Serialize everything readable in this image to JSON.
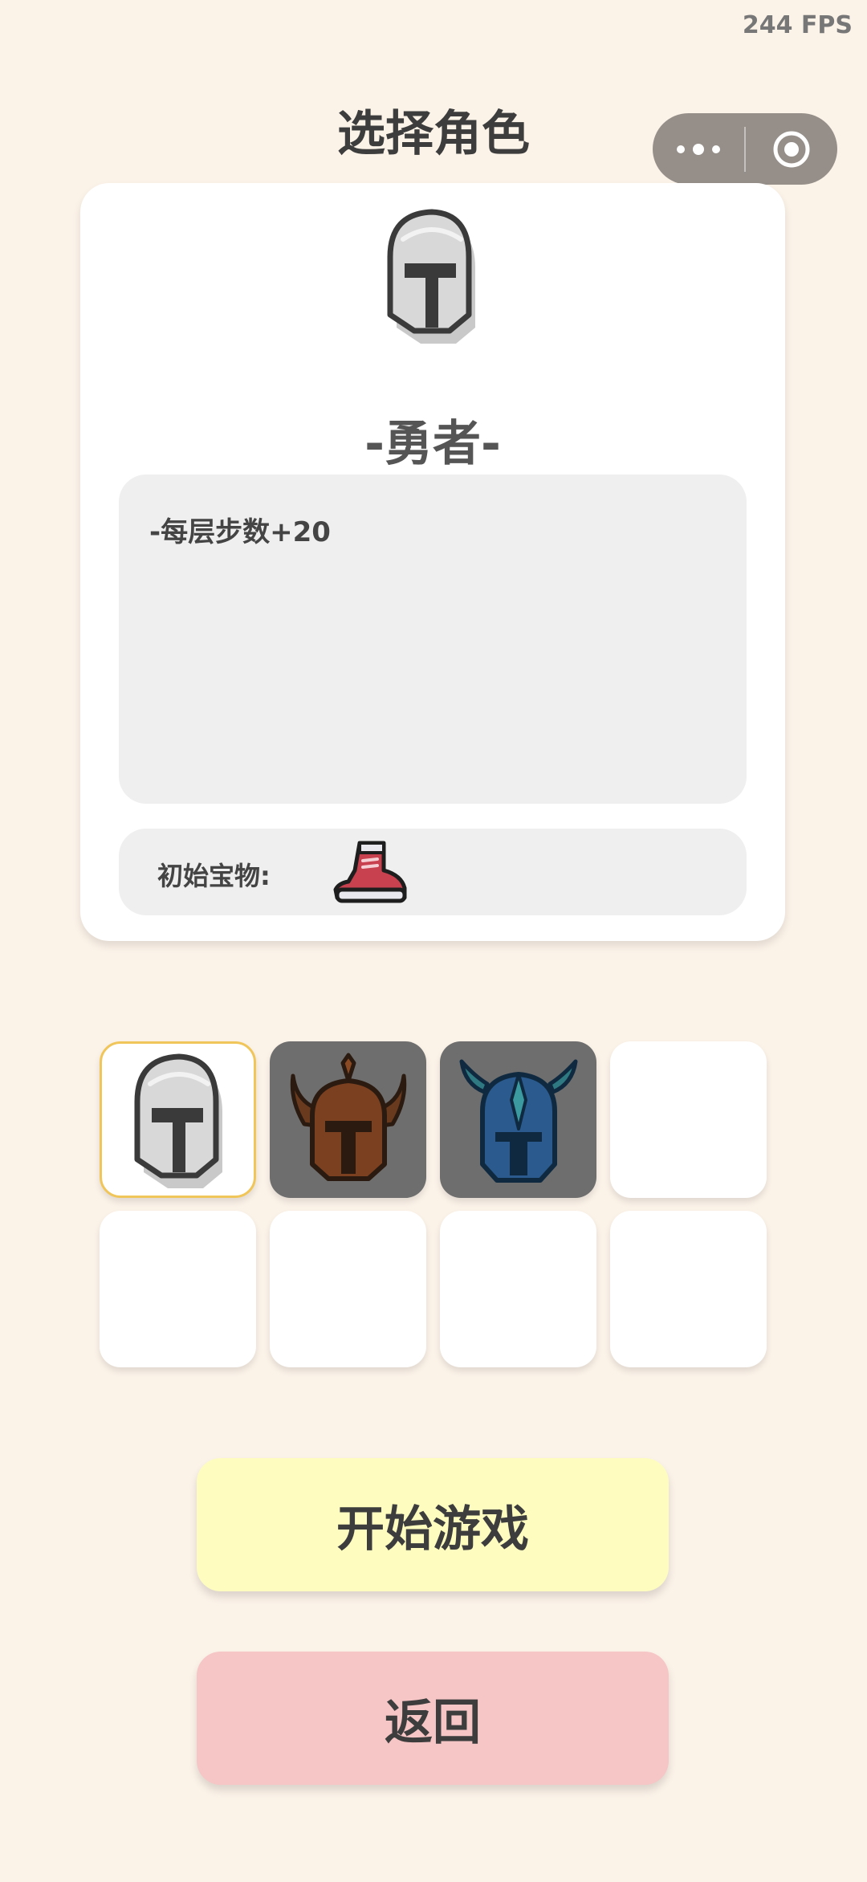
{
  "status": {
    "fps": "244 FPS"
  },
  "header": {
    "title": "选择角色"
  },
  "miniprogram_capsule": {
    "more_icon": "more-dots-icon",
    "close_icon": "target-circle-icon"
  },
  "character": {
    "name": "-勇者-",
    "description": "-每层步数+20",
    "icon": "knight-helmet-icon",
    "treasure_label": "初始宝物:",
    "treasure_icon": "boot-icon"
  },
  "roster": [
    {
      "icon": "knight-helmet-icon",
      "selected": true,
      "locked": false
    },
    {
      "icon": "horned-helmet-icon",
      "selected": false,
      "locked": true
    },
    {
      "icon": "winged-helmet-icon",
      "selected": false,
      "locked": true
    },
    {
      "icon": "",
      "selected": false,
      "locked": false
    },
    {
      "icon": "",
      "selected": false,
      "locked": false
    },
    {
      "icon": "",
      "selected": false,
      "locked": false
    },
    {
      "icon": "",
      "selected": false,
      "locked": false
    },
    {
      "icon": "",
      "selected": false,
      "locked": false
    }
  ],
  "buttons": {
    "start": "开始游戏",
    "back": "返回"
  },
  "colors": {
    "background": "#fbf2e8",
    "start_button": "#fffcc0",
    "back_button": "#f6c5c5",
    "selected_border": "#f0c55a",
    "locked_slot": "#6e6e6e"
  }
}
